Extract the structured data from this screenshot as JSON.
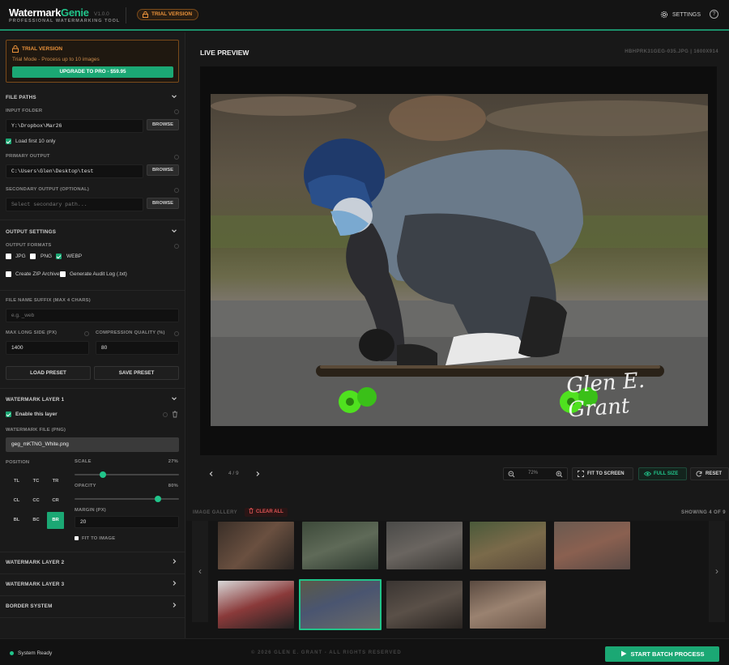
{
  "header": {
    "logo_part1": "Watermark",
    "logo_part2": "Genie",
    "version": "V1.0.0",
    "tagline": "PROFESSIONAL WATERMARKING TOOL",
    "trial_badge": "TRIAL VERSION",
    "settings_label": "SETTINGS",
    "help_icon_glyph": "?"
  },
  "trial": {
    "title": "TRIAL VERSION",
    "subtitle": "Trial Mode - Process up to 10 images",
    "upgrade_label": "UPGRADE TO PRO - $59.95"
  },
  "file_paths": {
    "header": "FILE PATHS",
    "input_label": "INPUT FOLDER",
    "input_value": "Y:\\Dropbox\\Mar26",
    "load_first_label": "Load first 10 only",
    "load_first_checked": true,
    "primary_label": "PRIMARY OUTPUT",
    "primary_value": "C:\\Users\\Glen\\Desktop\\test",
    "secondary_label": "SECONDARY OUTPUT (OPTIONAL)",
    "secondary_placeholder": "Select secondary path...",
    "browse_label": "BROWSE"
  },
  "output_settings": {
    "header": "OUTPUT SETTINGS",
    "formats_label": "OUTPUT FORMATS",
    "formats": [
      {
        "label": "JPG",
        "checked": false
      },
      {
        "label": "PNG",
        "checked": false
      },
      {
        "label": "WEBP",
        "checked": true
      }
    ],
    "zip_label": "Create ZIP Archive",
    "audit_label": "Generate Audit Log (.txt)",
    "suffix_label": "FILE NAME SUFFIX (MAX 4 CHARS)",
    "suffix_placeholder": "e.g. _web",
    "max_side_label": "MAX LONG SIDE (PX)",
    "max_side_value": "1400",
    "compression_label": "COMPRESSION QUALITY (%)",
    "compression_value": "80",
    "load_preset": "LOAD PRESET",
    "save_preset": "SAVE PRESET"
  },
  "watermark1": {
    "header": "WATERMARK LAYER 1",
    "enable_label": "Enable this layer",
    "enabled": true,
    "file_label": "WATERMARK FILE (PNG)",
    "file_value": "geg_mKTNG_White.png",
    "position_label": "POSITION",
    "positions": [
      "TL",
      "TC",
      "TR",
      "CL",
      "CC",
      "CR",
      "BL",
      "BC",
      "BR"
    ],
    "selected_position": "BR",
    "scale_label": "SCALE",
    "scale_value": "27%",
    "scale_fraction": 0.27,
    "opacity_label": "OPACITY",
    "opacity_value": "80%",
    "opacity_fraction": 0.8,
    "margin_label": "MARGIN (PX)",
    "margin_value": "20",
    "fit_label": "FIT TO IMAGE"
  },
  "layers": {
    "layer2": "WATERMARK LAYER 2",
    "layer3": "WATERMARK LAYER 3",
    "border": "BORDER SYSTEM"
  },
  "preview": {
    "title": "LIVE PREVIEW",
    "filename": "HBHPRK31GEG-035.JPG | 1600X914",
    "page_indicator": "4 / 9",
    "zoom_value": "72%",
    "fit_label": "FIT TO SCREEN",
    "full_label": "FULL SIZE",
    "reset_label": "RESET",
    "signature": "Glen E. Grant"
  },
  "gallery": {
    "title": "IMAGE GALLERY",
    "clear_label": "CLEAR ALL",
    "showing": "SHOWING 4 OF 9",
    "selected_index": 6
  },
  "footer": {
    "status": "System Ready",
    "copyright": "© 2026 GLEN E. GRANT - ALL RIGHTS RESERVED",
    "batch_label": "START BATCH PROCESS"
  },
  "colors": {
    "accent": "#1ba874",
    "warning": "#e8913a",
    "danger": "#e05555"
  }
}
